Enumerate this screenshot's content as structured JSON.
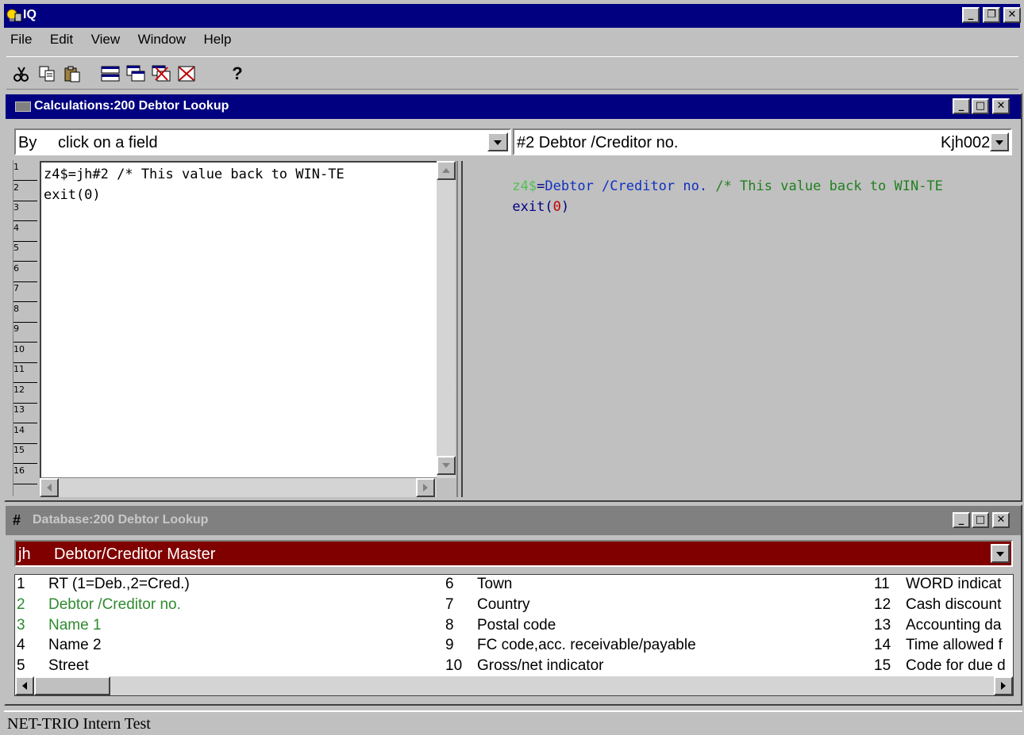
{
  "app": {
    "title": "IQ"
  },
  "menu": [
    "File",
    "Edit",
    "View",
    "Window",
    "Help"
  ],
  "toolbar": {
    "help_glyph": "?"
  },
  "calc_window": {
    "title": "Calculations:200  Debtor Lookup",
    "left_combo": {
      "prefix": "By",
      "value": "click on a field"
    },
    "right_combo": {
      "value": "#2  Debtor /Creditor no.",
      "code": "Kjh002"
    },
    "line_numbers": [
      "1",
      "2",
      "3",
      "4",
      "5",
      "6",
      "7",
      "8",
      "9",
      "10",
      "11",
      "12",
      "13",
      "14",
      "15",
      "16"
    ],
    "code_lines": [
      "z4$=jh#2 /* This value back to WIN-TE",
      "exit(0)"
    ],
    "preview": {
      "line1_var": "z4$",
      "line1_eq": "=",
      "line1_field": "Debtor /Creditor no.",
      "line1_comment": " /* This value back to WIN-TE",
      "line2_kw": "exit(",
      "line2_arg": "0",
      "line2_close": ")"
    }
  },
  "db_window": {
    "title": "Database:200  Debtor Lookup",
    "table_code": "jh",
    "table_name": "Debtor/Creditor Master",
    "fields": [
      {
        "n": "1",
        "label": "RT (1=Deb.,2=Cred.)"
      },
      {
        "n": "2",
        "label": "Debtor /Creditor no."
      },
      {
        "n": "3",
        "label": "Name 1"
      },
      {
        "n": "4",
        "label": "Name 2"
      },
      {
        "n": "5",
        "label": "Street"
      },
      {
        "n": "6",
        "label": "Town"
      },
      {
        "n": "7",
        "label": "Country"
      },
      {
        "n": "8",
        "label": "Postal code"
      },
      {
        "n": "9",
        "label": "FC code,acc. receivable/payable"
      },
      {
        "n": "10",
        "label": "Gross/net indicator"
      },
      {
        "n": "11",
        "label": "WORD indicat"
      },
      {
        "n": "12",
        "label": "Cash discount"
      },
      {
        "n": "13",
        "label": "Accounting da"
      },
      {
        "n": "14",
        "label": "Time allowed f"
      },
      {
        "n": "15",
        "label": "Code for due d"
      }
    ],
    "highlight_color": "#2e8b2e"
  },
  "status": {
    "text": "NET-TRIO Intern Test"
  }
}
